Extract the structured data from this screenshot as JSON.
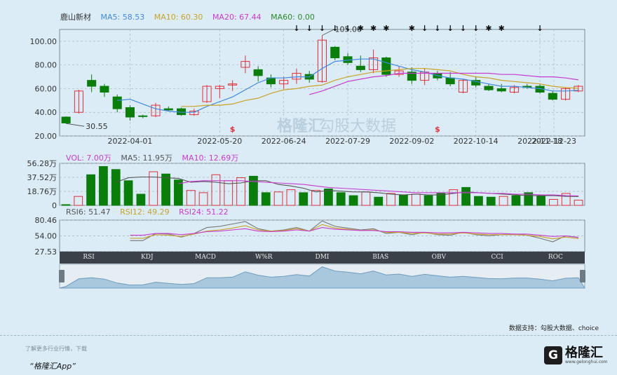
{
  "chart_data": [
    {
      "type": "candlestick",
      "legend": [
        {
          "label": "鹿山新材",
          "color": "#333333"
        },
        {
          "label": "MA5: 58.53",
          "color": "#3f8ae0"
        },
        {
          "label": "MA10: 60.30",
          "color": "#c9a227"
        },
        {
          "label": "MA20: 67.44",
          "color": "#c83ad0"
        },
        {
          "label": "MA60: 0.00",
          "color": "#2a8a2a"
        }
      ],
      "y_ticks": [
        "100.00",
        "80.00",
        "60.00",
        "40.00",
        "20.00"
      ],
      "ylim": [
        20,
        110
      ],
      "x_ticks": [
        "2022-04-01",
        "2022-05-20",
        "2022-06-24",
        "2022-07-29",
        "2022-09-02",
        "2022-10-14",
        "2022-11-18",
        "2022-12-23"
      ],
      "annotations": {
        "high": "105.00",
        "low": "30.55"
      },
      "candles": [
        {
          "o": 36,
          "h": 36.5,
          "l": 30.55,
          "c": 31
        },
        {
          "o": 40,
          "h": 59,
          "l": 39,
          "c": 58
        },
        {
          "o": 67,
          "h": 72,
          "l": 57,
          "c": 62
        },
        {
          "o": 62,
          "h": 64,
          "l": 53,
          "c": 57
        },
        {
          "o": 53,
          "h": 55,
          "l": 40,
          "c": 43
        },
        {
          "o": 44,
          "h": 46,
          "l": 33,
          "c": 36
        },
        {
          "o": 37,
          "h": 38,
          "l": 35,
          "c": 36.5
        },
        {
          "o": 37,
          "h": 48,
          "l": 36,
          "c": 46
        },
        {
          "o": 43,
          "h": 45,
          "l": 41,
          "c": 42
        },
        {
          "o": 43,
          "h": 44,
          "l": 37,
          "c": 38
        },
        {
          "o": 38,
          "h": 43,
          "l": 37,
          "c": 41
        },
        {
          "o": 49,
          "h": 63,
          "l": 48,
          "c": 62
        },
        {
          "o": 60,
          "h": 63,
          "l": 52,
          "c": 62
        },
        {
          "o": 63,
          "h": 67,
          "l": 58,
          "c": 64
        },
        {
          "o": 78,
          "h": 88,
          "l": 73,
          "c": 83
        },
        {
          "o": 76,
          "h": 79,
          "l": 66,
          "c": 71
        },
        {
          "o": 69,
          "h": 72,
          "l": 61,
          "c": 64
        },
        {
          "o": 64,
          "h": 70,
          "l": 60,
          "c": 67
        },
        {
          "o": 68,
          "h": 77,
          "l": 64,
          "c": 73
        },
        {
          "o": 72,
          "h": 75,
          "l": 65,
          "c": 68
        },
        {
          "o": 66,
          "h": 105,
          "l": 65,
          "c": 101
        },
        {
          "o": 95,
          "h": 96,
          "l": 84,
          "c": 86
        },
        {
          "o": 87,
          "h": 90,
          "l": 80,
          "c": 82
        },
        {
          "o": 79,
          "h": 88,
          "l": 74,
          "c": 76
        },
        {
          "o": 76,
          "h": 93,
          "l": 73,
          "c": 86
        },
        {
          "o": 86,
          "h": 87,
          "l": 70,
          "c": 72
        },
        {
          "o": 72,
          "h": 79,
          "l": 70,
          "c": 75
        },
        {
          "o": 74,
          "h": 78,
          "l": 64,
          "c": 67
        },
        {
          "o": 67,
          "h": 77,
          "l": 63,
          "c": 74
        },
        {
          "o": 73,
          "h": 75,
          "l": 67,
          "c": 69
        },
        {
          "o": 69,
          "h": 74,
          "l": 62,
          "c": 64
        },
        {
          "o": 57,
          "h": 68,
          "l": 56,
          "c": 67
        },
        {
          "o": 67,
          "h": 70,
          "l": 61,
          "c": 63
        },
        {
          "o": 62,
          "h": 64,
          "l": 58,
          "c": 59
        },
        {
          "o": 60,
          "h": 64,
          "l": 57,
          "c": 58
        },
        {
          "o": 57,
          "h": 63,
          "l": 56,
          "c": 61
        },
        {
          "o": 62,
          "h": 64,
          "l": 60,
          "c": 61
        },
        {
          "o": 62,
          "h": 64,
          "l": 56,
          "c": 57
        },
        {
          "o": 56,
          "h": 58,
          "l": 50,
          "c": 51
        },
        {
          "o": 51,
          "h": 61,
          "l": 50,
          "c": 60
        },
        {
          "o": 58,
          "h": 63,
          "l": 57,
          "c": 62
        }
      ],
      "ma5": [
        null,
        null,
        null,
        null,
        50,
        51,
        47,
        43,
        41,
        40,
        40,
        45,
        49,
        53,
        59,
        65,
        69,
        69,
        70,
        70,
        77,
        83,
        84,
        85,
        85,
        82,
        79,
        76,
        74,
        71,
        69,
        68,
        66,
        64,
        62,
        62,
        61,
        60,
        58,
        58,
        58.53
      ],
      "ma10": [
        null,
        null,
        null,
        null,
        null,
        null,
        null,
        null,
        null,
        45,
        45,
        46,
        46,
        47,
        50,
        52,
        56,
        59,
        60,
        62,
        63,
        67,
        70,
        72,
        74,
        75,
        76,
        77,
        77,
        76,
        75,
        72,
        70,
        69,
        67,
        66,
        65,
        64,
        62,
        61,
        60.3
      ],
      "ma20": [
        null,
        null,
        null,
        null,
        null,
        null,
        null,
        null,
        null,
        null,
        null,
        null,
        null,
        null,
        null,
        null,
        null,
        null,
        null,
        55,
        58,
        62,
        66,
        68,
        70,
        71,
        73,
        73,
        73,
        73,
        73,
        73,
        73,
        73,
        72,
        72,
        71,
        70,
        70,
        69,
        67.44
      ],
      "markers_top": [
        "↓",
        "↓",
        "↓",
        "↓",
        "↓",
        "✱",
        "✱",
        "✱",
        "✱",
        "↓",
        "↓",
        "↓",
        "↓",
        "↓",
        "✱",
        "✱",
        "↓"
      ],
      "markers_bottom": [
        "$",
        "$"
      ]
    },
    {
      "type": "bar",
      "legend": [
        {
          "label": "VOL: 7.00万",
          "color": "#c83ad0"
        },
        {
          "label": "MA5: 11.95万",
          "color": "#555555"
        },
        {
          "label": "MA10: 12.69万",
          "color": "#c83ad0"
        }
      ],
      "y_ticks": [
        "56.28万",
        "37.52万",
        "18.76万",
        "0"
      ],
      "ylim": [
        0,
        56.28
      ],
      "values": [
        1,
        12,
        41,
        52,
        48,
        33,
        15,
        45,
        42,
        34,
        20,
        17,
        41,
        33,
        37,
        39,
        17,
        18,
        21,
        17,
        20,
        22,
        17,
        13,
        18,
        11,
        16,
        14,
        15,
        13,
        16,
        21,
        24,
        12,
        11,
        12,
        13,
        17,
        13,
        8,
        16,
        7
      ],
      "vol_ma5": [
        null,
        null,
        null,
        null,
        31,
        37,
        38,
        38,
        37,
        36,
        31,
        32,
        31,
        29,
        30,
        33,
        33,
        28,
        26,
        23,
        18,
        20,
        19,
        18,
        18,
        17,
        15,
        14,
        15,
        14,
        14,
        16,
        18,
        17,
        16,
        15,
        14,
        13,
        13,
        13,
        12,
        11.95
      ],
      "vol_ma10": [
        null,
        null,
        null,
        null,
        null,
        null,
        null,
        null,
        null,
        29,
        32,
        33,
        33,
        33,
        33,
        32,
        31,
        30,
        29,
        28,
        26,
        24,
        23,
        22,
        21,
        20,
        19,
        18,
        17,
        17,
        17,
        17,
        17,
        17,
        16,
        16,
        15,
        15,
        14,
        14,
        13,
        12.69
      ]
    },
    {
      "type": "line",
      "legend": [
        {
          "label": "RSI6: 51.47",
          "color": "#555555"
        },
        {
          "label": "RSI12: 49.29",
          "color": "#c9a227"
        },
        {
          "label": "RSI24: 51.22",
          "color": "#c83ad0"
        }
      ],
      "y_ticks": [
        "80.46",
        "54.00",
        "27.53"
      ],
      "ylim": [
        27.53,
        80.46
      ],
      "series": [
        {
          "name": "RSI6",
          "color": "#777777",
          "values": [
            null,
            null,
            null,
            null,
            null,
            46,
            46,
            58,
            57,
            52,
            58,
            68,
            70,
            74,
            78,
            66,
            62,
            64,
            68,
            62,
            79,
            70,
            67,
            64,
            66,
            58,
            60,
            56,
            60,
            56,
            55,
            60,
            56,
            54,
            56,
            57,
            55,
            50,
            44,
            54,
            51.47
          ]
        },
        {
          "name": "RSI12",
          "color": "#c9a227",
          "values": [
            null,
            null,
            null,
            null,
            null,
            50,
            50,
            56,
            55,
            53,
            57,
            62,
            64,
            67,
            71,
            64,
            62,
            63,
            66,
            62,
            73,
            67,
            65,
            63,
            64,
            60,
            60,
            58,
            59,
            57,
            57,
            59,
            57,
            56,
            56,
            56,
            55,
            53,
            49,
            52,
            49.29
          ]
        },
        {
          "name": "RSI24",
          "color": "#c83ad0",
          "values": [
            null,
            null,
            null,
            null,
            null,
            55,
            55,
            58,
            58,
            56,
            58,
            61,
            62,
            64,
            66,
            62,
            61,
            62,
            64,
            62,
            68,
            65,
            64,
            63,
            63,
            61,
            61,
            60,
            60,
            59,
            59,
            60,
            59,
            58,
            58,
            57,
            57,
            55,
            53,
            54,
            51.22
          ]
        }
      ]
    }
  ],
  "tabs": [
    "RSI",
    "KDJ",
    "MACD",
    "W%R",
    "DMI",
    "BIAS",
    "OBV",
    "CCI",
    "ROC"
  ],
  "active_tab": "RSI",
  "watermarks": [
    "格隆汇",
    "勾股大数据"
  ],
  "footer": {
    "source": "数据支持：勾股大数据、choice",
    "app": "“格隆汇App”",
    "faint_text": "了解更多行业行情，下载"
  },
  "brand": {
    "name": "格隆汇",
    "mark": "G",
    "url": "www.gelonghui.com"
  },
  "colors": {
    "up": "#e0303a",
    "down": "#0a7d0a",
    "grid": "#aab4ba",
    "panel": "#dcecf6"
  }
}
